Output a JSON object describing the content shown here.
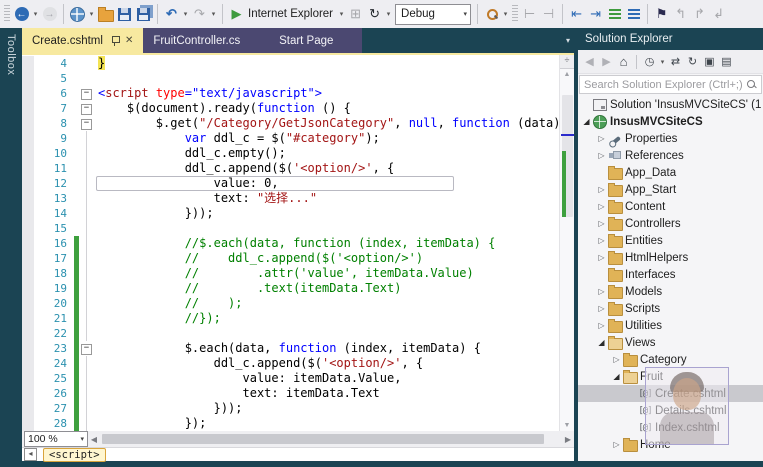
{
  "window": {
    "chrome_color": "#1B4453",
    "active_tab_color": "#F7E9A0",
    "inactive_tab_color": "#4B4871"
  },
  "toolbar": {
    "run_target": "Internet Explorer",
    "config": "Debug",
    "icons": [
      "back",
      "forward",
      "new-web-site",
      "open-file",
      "save",
      "save-all",
      "undo",
      "redo",
      "run",
      "attach-to-process",
      "refresh",
      "find-in-files",
      "navigate-backward",
      "navigate-forward",
      "decrease-indent",
      "increase-indent",
      "comment-selection",
      "uncomment-selection",
      "toggle-bookmark",
      "previous-bookmark",
      "next-bookmark"
    ]
  },
  "toolbox": {
    "label": "Toolbox"
  },
  "tabs": [
    {
      "label": "Create.cshtml",
      "active": true
    },
    {
      "label": "FruitController.cs",
      "active": false
    },
    {
      "label": "Start Page",
      "active": false
    }
  ],
  "editor": {
    "zoom_level": "100 %",
    "tag_breadcrumb": "<script>",
    "colors": {
      "keyword": "#0000FF",
      "string": "#A31515",
      "comment": "#008000",
      "line_number": "#2B91AF",
      "change_bar": "#3EA03E",
      "brace_highlight": "#F3E354"
    },
    "lines": [
      {
        "n": 4,
        "segs": [
          [
            "hl",
            "}"
          ]
        ]
      },
      {
        "n": 5,
        "segs": []
      },
      {
        "n": 6,
        "fold": true,
        "segs": [
          [
            "d",
            "<"
          ],
          [
            "tag",
            "script"
          ],
          [
            "t",
            " "
          ],
          [
            "attr",
            "type"
          ],
          [
            "d",
            "=\"text/javascript\""
          ],
          [
            "d",
            ">"
          ]
        ]
      },
      {
        "n": 7,
        "fold": true,
        "segs": [
          [
            "t",
            "    $(document).ready("
          ],
          [
            "k",
            "function"
          ],
          [
            "t",
            " () {"
          ]
        ]
      },
      {
        "n": 8,
        "fold": true,
        "segs": [
          [
            "t",
            "        $.get("
          ],
          [
            "s",
            "\"/Category/GetJsonCategory\""
          ],
          [
            "t",
            ", "
          ],
          [
            "k",
            "null"
          ],
          [
            "t",
            ", "
          ],
          [
            "k",
            "function"
          ],
          [
            "t",
            " (data) {"
          ]
        ]
      },
      {
        "n": 9,
        "guide": true,
        "segs": [
          [
            "t",
            "            "
          ],
          [
            "k",
            "var"
          ],
          [
            "t",
            " ddl_c = $("
          ],
          [
            "s",
            "\"#category\""
          ],
          [
            "t",
            ");"
          ]
        ]
      },
      {
        "n": 10,
        "guide": true,
        "segs": [
          [
            "t",
            "            ddl_c.empty();"
          ]
        ]
      },
      {
        "n": 11,
        "guide": true,
        "segs": [
          [
            "t",
            "            ddl_c.append($("
          ],
          [
            "s",
            "'<option/>'"
          ],
          [
            "t",
            ", {"
          ]
        ]
      },
      {
        "n": 12,
        "guide": true,
        "boxed": true,
        "segs": [
          [
            "t",
            "                value: 0,"
          ]
        ]
      },
      {
        "n": 13,
        "guide": true,
        "segs": [
          [
            "t",
            "                text: "
          ],
          [
            "s",
            "\"选择...\""
          ]
        ]
      },
      {
        "n": 14,
        "guide": true,
        "segs": [
          [
            "t",
            "            }));"
          ]
        ]
      },
      {
        "n": 15,
        "guide": true,
        "segs": []
      },
      {
        "n": 16,
        "guide": true,
        "changed": true,
        "segs": [
          [
            "c",
            "            //$.each(data, function (index, itemData) {"
          ]
        ]
      },
      {
        "n": 17,
        "guide": true,
        "changed": true,
        "segs": [
          [
            "c",
            "            //    ddl_c.append($('<option/>')"
          ]
        ]
      },
      {
        "n": 18,
        "guide": true,
        "changed": true,
        "segs": [
          [
            "c",
            "            //        .attr('value', itemData.Value)"
          ]
        ]
      },
      {
        "n": 19,
        "guide": true,
        "changed": true,
        "segs": [
          [
            "c",
            "            //        .text(itemData.Text)"
          ]
        ]
      },
      {
        "n": 20,
        "guide": true,
        "changed": true,
        "segs": [
          [
            "c",
            "            //    );"
          ]
        ]
      },
      {
        "n": 21,
        "guide": true,
        "changed": true,
        "segs": [
          [
            "c",
            "            //});"
          ]
        ]
      },
      {
        "n": 22,
        "guide": true,
        "changed": true,
        "segs": []
      },
      {
        "n": 23,
        "fold": true,
        "changed": true,
        "segs": [
          [
            "t",
            "            $.each(data, "
          ],
          [
            "k",
            "function"
          ],
          [
            "t",
            " (index, itemData) {"
          ]
        ]
      },
      {
        "n": 24,
        "guide": true,
        "changed": true,
        "segs": [
          [
            "t",
            "                ddl_c.append($("
          ],
          [
            "s",
            "'<option/>'"
          ],
          [
            "t",
            ", {"
          ]
        ]
      },
      {
        "n": 25,
        "guide": true,
        "changed": true,
        "segs": [
          [
            "t",
            "                    value: itemData.Value,"
          ]
        ]
      },
      {
        "n": 26,
        "guide": true,
        "changed": true,
        "segs": [
          [
            "t",
            "                    text: itemData.Text"
          ]
        ]
      },
      {
        "n": 27,
        "guide": true,
        "changed": true,
        "segs": [
          [
            "t",
            "                }));"
          ]
        ]
      },
      {
        "n": 28,
        "guide": true,
        "changed": true,
        "segs": [
          [
            "t",
            "            });"
          ]
        ]
      }
    ]
  },
  "solution_explorer": {
    "title": "Solution Explorer",
    "search_placeholder": "Search Solution Explorer (Ctrl+;)",
    "toolbar_icons": [
      "back",
      "forward",
      "home",
      "pending-changes-filter",
      "sync-with-active-document",
      "refresh",
      "collapse-all",
      "properties"
    ],
    "tree": [
      {
        "label": "Solution 'InsusMVCSiteCS' (1",
        "icon": "solution",
        "indent": 0,
        "expander": "none"
      },
      {
        "label": "InsusMVCSiteCS",
        "icon": "web-project",
        "indent": 0,
        "expander": "open",
        "bold": true
      },
      {
        "label": "Properties",
        "icon": "properties",
        "indent": 1,
        "expander": "closed"
      },
      {
        "label": "References",
        "icon": "references",
        "indent": 1,
        "expander": "closed"
      },
      {
        "label": "App_Data",
        "icon": "folder",
        "indent": 1,
        "expander": "none"
      },
      {
        "label": "App_Start",
        "icon": "folder",
        "indent": 1,
        "expander": "closed"
      },
      {
        "label": "Content",
        "icon": "folder",
        "indent": 1,
        "expander": "closed"
      },
      {
        "label": "Controllers",
        "icon": "folder",
        "indent": 1,
        "expander": "closed"
      },
      {
        "label": "Entities",
        "icon": "folder",
        "indent": 1,
        "expander": "closed"
      },
      {
        "label": "HtmlHelpers",
        "icon": "folder",
        "indent": 1,
        "expander": "closed"
      },
      {
        "label": "Interfaces",
        "icon": "folder",
        "indent": 1,
        "expander": "none"
      },
      {
        "label": "Models",
        "icon": "folder",
        "indent": 1,
        "expander": "closed"
      },
      {
        "label": "Scripts",
        "icon": "folder",
        "indent": 1,
        "expander": "closed"
      },
      {
        "label": "Utilities",
        "icon": "folder",
        "indent": 1,
        "expander": "closed"
      },
      {
        "label": "Views",
        "icon": "folder-open",
        "indent": 1,
        "expander": "open"
      },
      {
        "label": "Category",
        "icon": "folder",
        "indent": 2,
        "expander": "closed"
      },
      {
        "label": "Fruit",
        "icon": "folder-open",
        "indent": 2,
        "expander": "open"
      },
      {
        "label": "Create.cshtml",
        "icon": "razor-view",
        "indent": 3,
        "expander": "none",
        "selected": true
      },
      {
        "label": "Details.cshtml",
        "icon": "razor-view",
        "indent": 3,
        "expander": "none"
      },
      {
        "label": "Index.cshtml",
        "icon": "razor-view",
        "indent": 3,
        "expander": "none"
      },
      {
        "label": "Home",
        "icon": "folder",
        "indent": 2,
        "expander": "closed"
      }
    ]
  }
}
